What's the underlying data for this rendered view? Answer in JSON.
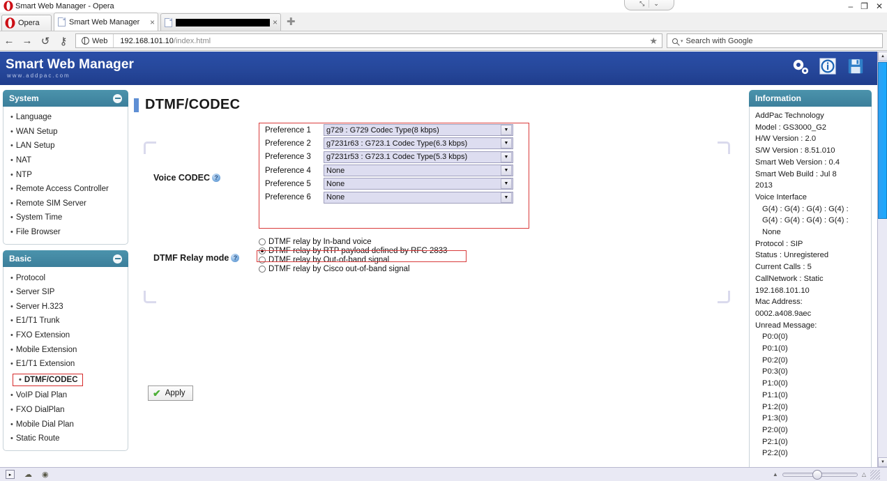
{
  "window": {
    "title": "Smart Web Manager - Opera",
    "minimize": "–",
    "restore": "❐",
    "close": "✕",
    "tabgroup_expand": "⤡",
    "tabgroup_caret": "⌄"
  },
  "browser": {
    "menu_label": "Opera",
    "tabs": [
      {
        "title": "Smart Web Manager",
        "close": "×",
        "active": true,
        "redacted": false
      },
      {
        "title": "",
        "close": "×",
        "active": false,
        "redacted": true
      }
    ],
    "new_tab": "✚",
    "nav": {
      "back": "←",
      "forward": "→",
      "reload": "↺",
      "security": "⚷"
    },
    "address": {
      "scope_label": "Web",
      "url_host": "192.168.101.10",
      "url_path": "/index.html",
      "bookmark_star": "★"
    },
    "search": {
      "placeholder": "Search with Google",
      "value": "Search with Google",
      "caret": "▾"
    },
    "statusbar": {
      "panel_toggle": "▸",
      "icon_a": "▬",
      "icon_b": "●",
      "zoom_out_marker": "▲",
      "zoom_in_marker": "△"
    }
  },
  "app": {
    "brand": "Smart Web Manager",
    "brand_sub": "www.addpac.com",
    "header_icons": [
      {
        "name": "gear-icon",
        "glyph": "⚙"
      },
      {
        "name": "info-icon",
        "glyph": "ℹ"
      },
      {
        "name": "save-icon",
        "glyph": "Ὃe"
      }
    ]
  },
  "sidebar": {
    "panels": [
      {
        "title": "System",
        "collapse": "⊖",
        "items": [
          {
            "label": "Language",
            "selected": false
          },
          {
            "label": "WAN Setup",
            "selected": false
          },
          {
            "label": "LAN Setup",
            "selected": false
          },
          {
            "label": "NAT",
            "selected": false
          },
          {
            "label": "NTP",
            "selected": false
          },
          {
            "label": "Remote Access Controller",
            "selected": false
          },
          {
            "label": "Remote SIM Server",
            "selected": false
          },
          {
            "label": "System Time",
            "selected": false
          },
          {
            "label": "File Browser",
            "selected": false
          }
        ]
      },
      {
        "title": "Basic",
        "collapse": "⊖",
        "items": [
          {
            "label": "Protocol",
            "selected": false
          },
          {
            "label": "Server SIP",
            "selected": false
          },
          {
            "label": "Server H.323",
            "selected": false
          },
          {
            "label": "E1/T1 Trunk",
            "selected": false
          },
          {
            "label": "FXO Extension",
            "selected": false
          },
          {
            "label": "Mobile Extension",
            "selected": false
          },
          {
            "label": "E1/T1 Extension",
            "selected": false
          },
          {
            "label": "DTMF/CODEC",
            "selected": true
          },
          {
            "label": "VoIP Dial Plan",
            "selected": false
          },
          {
            "label": "FXO DialPlan",
            "selected": false
          },
          {
            "label": "Mobile Dial Plan",
            "selected": false
          },
          {
            "label": "Static Route",
            "selected": false
          }
        ]
      }
    ]
  },
  "main": {
    "page_title": "DTMF/CODEC",
    "voice_codec": {
      "label": "Voice CODEC",
      "help": "?",
      "rows": [
        {
          "label": "Preference 1",
          "value": "g729 : G729 Codec Type(8 kbps)"
        },
        {
          "label": "Preference 2",
          "value": "g7231r63 : G723.1 Codec Type(6.3 kbps)"
        },
        {
          "label": "Preference 3",
          "value": "g7231r53 : G723.1 Codec Type(5.3 kbps)"
        },
        {
          "label": "Preference 4",
          "value": "None"
        },
        {
          "label": "Preference 5",
          "value": "None"
        },
        {
          "label": "Preference 6",
          "value": "None"
        }
      ],
      "dropdown_arrow": "▼"
    },
    "dtmf_relay": {
      "label": "DTMF Relay mode",
      "help": "?",
      "options": [
        {
          "label": "DTMF relay by In-band voice",
          "checked": false
        },
        {
          "label": "DTMF relay by RTP payload defined by RFC 2833",
          "checked": true
        },
        {
          "label": "DTMF relay by Out-of-band signal",
          "checked": false
        },
        {
          "label": "DTMF relay by Cisco out-of-band signal",
          "checked": false
        }
      ]
    },
    "apply": {
      "label": "Apply",
      "check": "✔"
    }
  },
  "information": {
    "title": "Information",
    "lines": [
      {
        "text": "AddPac Technology",
        "indent": false
      },
      {
        "text": "Model : GS3000_G2",
        "indent": false
      },
      {
        "text": "H/W Version : 2.0",
        "indent": false
      },
      {
        "text": "S/W Version : 8.51.010",
        "indent": false
      },
      {
        "text": "Smart Web Version : 0.4",
        "indent": false
      },
      {
        "text": "Smart Web Build : Jul 8",
        "indent": false
      },
      {
        "text": "2013",
        "indent": false
      },
      {
        "text": "Voice Interface",
        "indent": false
      },
      {
        "text": "G(4) : G(4) : G(4) : G(4) :",
        "indent": true
      },
      {
        "text": "G(4) : G(4) : G(4) : G(4) :",
        "indent": true
      },
      {
        "text": "None",
        "indent": true
      },
      {
        "text": "Protocol : SIP",
        "indent": false
      },
      {
        "text": "Status : Unregistered",
        "indent": false
      },
      {
        "text": "Current Calls : 5",
        "indent": false
      },
      {
        "text": "CallNetwork : Static",
        "indent": false
      },
      {
        "text": "192.168.101.10",
        "indent": false
      },
      {
        "text": "Mac Address:",
        "indent": false
      },
      {
        "text": "0002.a408.9aec",
        "indent": false
      },
      {
        "text": "Unread Message:",
        "indent": false
      },
      {
        "text": "P0:0(0)",
        "indent": true
      },
      {
        "text": "P0:1(0)",
        "indent": true
      },
      {
        "text": "P0:2(0)",
        "indent": true
      },
      {
        "text": "P0:3(0)",
        "indent": true
      },
      {
        "text": "P1:0(0)",
        "indent": true
      },
      {
        "text": "P1:1(0)",
        "indent": true
      },
      {
        "text": "P1:2(0)",
        "indent": true
      },
      {
        "text": "P1:3(0)",
        "indent": true
      },
      {
        "text": "P2:0(0)",
        "indent": true
      },
      {
        "text": "P2:1(0)",
        "indent": true
      },
      {
        "text": "P2:2(0)",
        "indent": true
      }
    ]
  },
  "colors": {
    "brand_blue": "#26479a",
    "panel_teal": "#3c7f9b",
    "highlight_red": "#d93b3b",
    "scrollbar_thumb": "#19aaff",
    "select_bg": "#ddddf0"
  }
}
